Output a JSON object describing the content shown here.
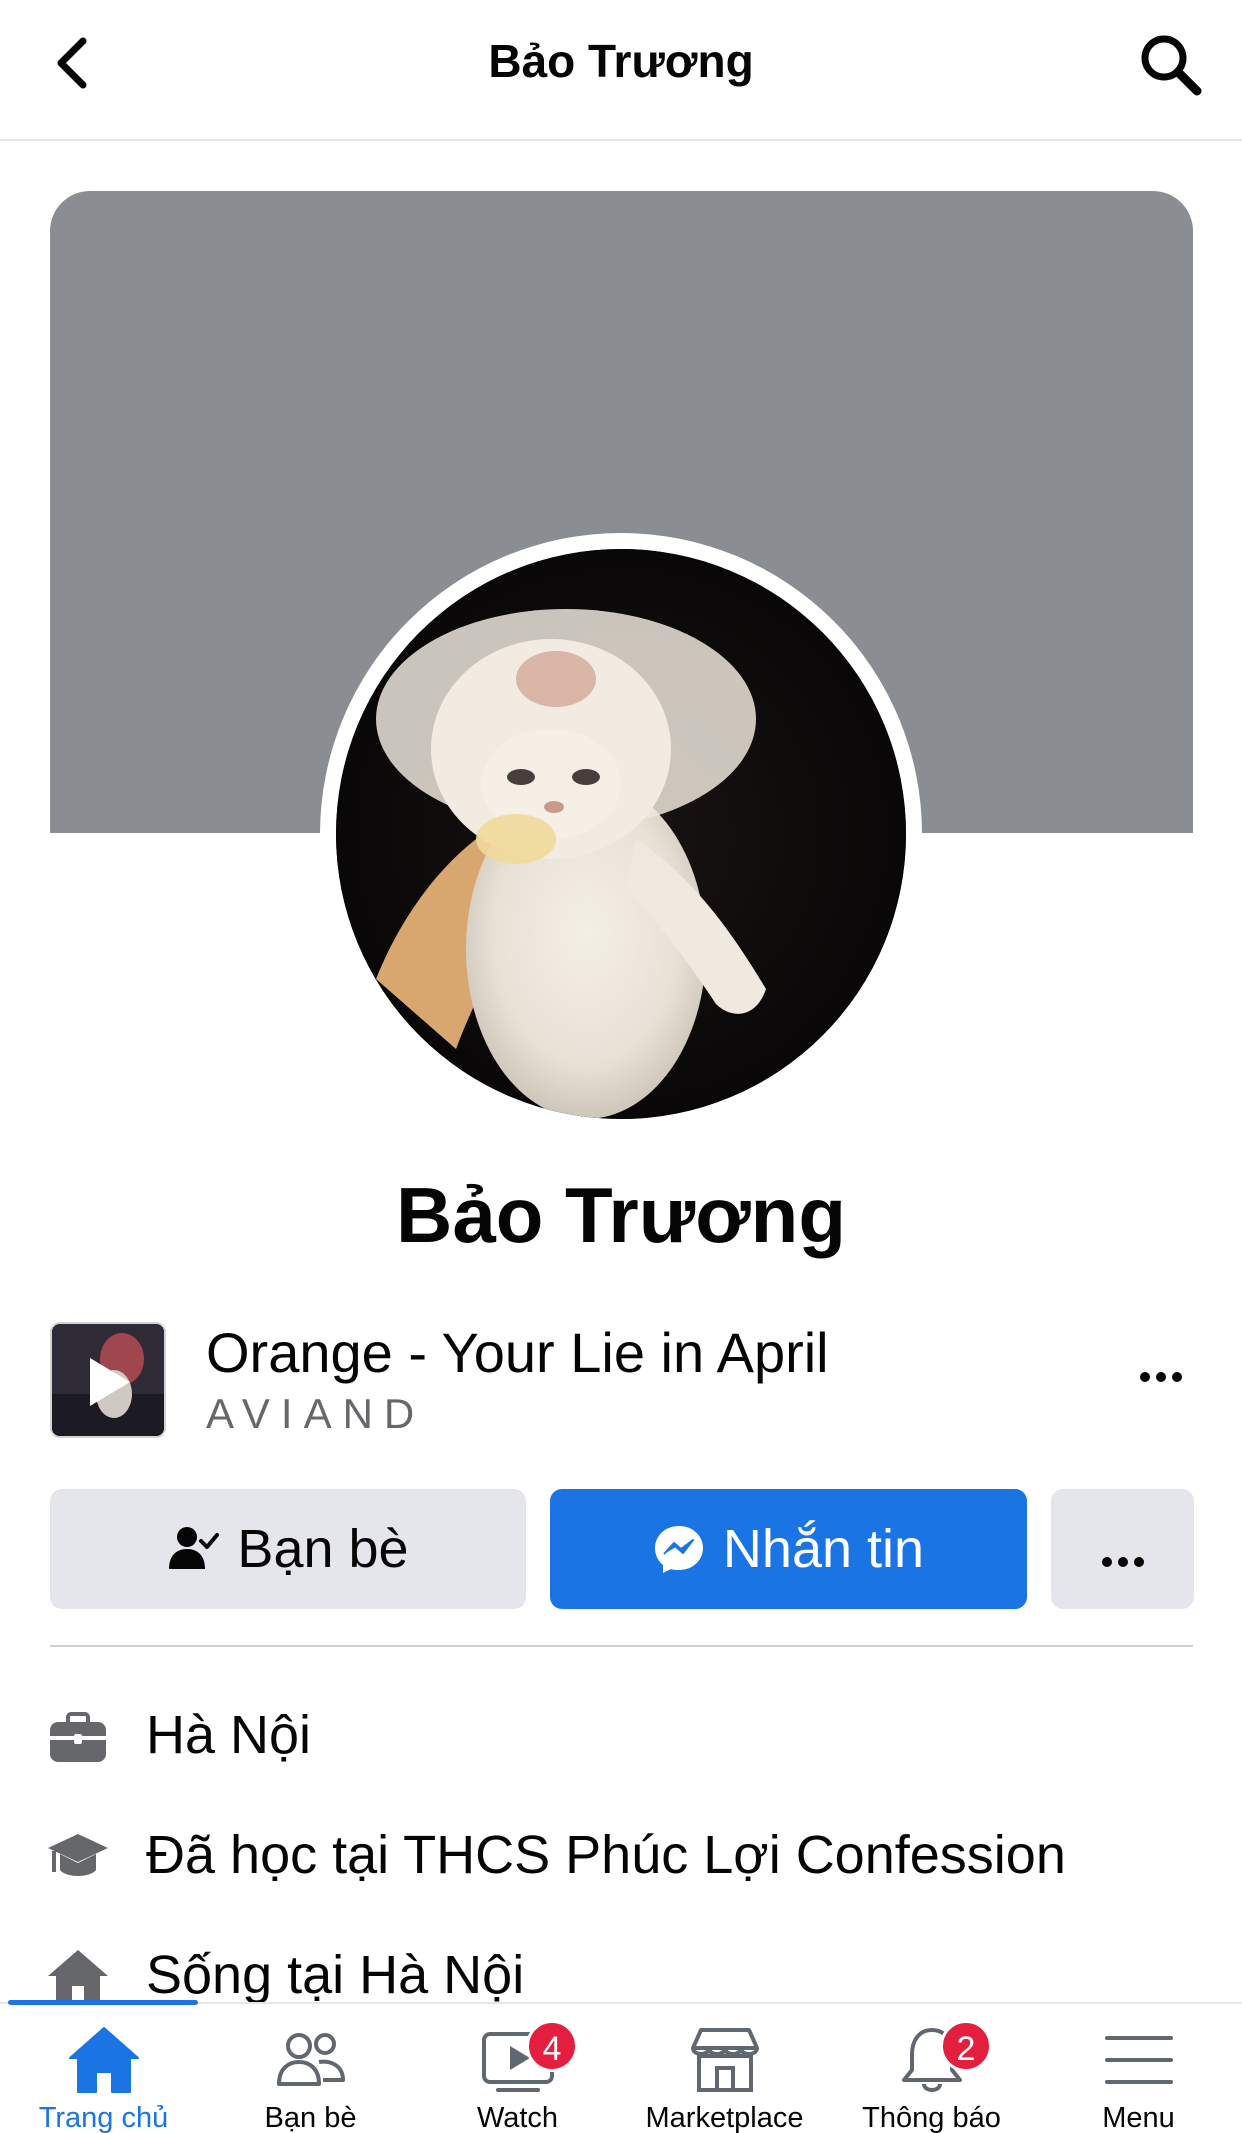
{
  "header": {
    "title": "Bảo Trương",
    "back_icon": "chevron-left-icon",
    "search_icon": "search-icon"
  },
  "profile": {
    "name": "Bảo Trương",
    "cover_color": "#8a8d91",
    "avatar": "fluffy-white-kitten-photo"
  },
  "music": {
    "title": "Orange - Your Lie in April",
    "artist": "AVIAND",
    "thumb_icon": "play-icon",
    "more_icon": "more-horizontal-icon"
  },
  "actions": {
    "friends_label": "Bạn bè",
    "friends_icon": "person-check-icon",
    "message_label": "Nhắn tin",
    "message_icon": "messenger-icon",
    "more_icon": "more-horizontal-icon"
  },
  "info": [
    {
      "icon": "briefcase-icon",
      "text": "Hà Nội"
    },
    {
      "icon": "graduation-cap-icon",
      "text": "Đã học tại THCS Phúc Lợi Confession"
    },
    {
      "icon": "home-icon",
      "text": "Sống tại Hà Nội"
    }
  ],
  "nav": {
    "items": [
      {
        "label": "Trang chủ",
        "icon": "home-icon",
        "active": true
      },
      {
        "label": "Bạn bè",
        "icon": "friends-icon"
      },
      {
        "label": "Watch",
        "icon": "watch-video-icon",
        "badge": "4"
      },
      {
        "label": "Marketplace",
        "icon": "marketplace-store-icon"
      },
      {
        "label": "Thông báo",
        "icon": "bell-icon",
        "badge": "2"
      },
      {
        "label": "Menu",
        "icon": "hamburger-menu-icon"
      }
    ]
  },
  "colors": {
    "accent": "#1b74e4",
    "badge": "#e41e3f",
    "button_secondary": "#e4e6eb"
  }
}
